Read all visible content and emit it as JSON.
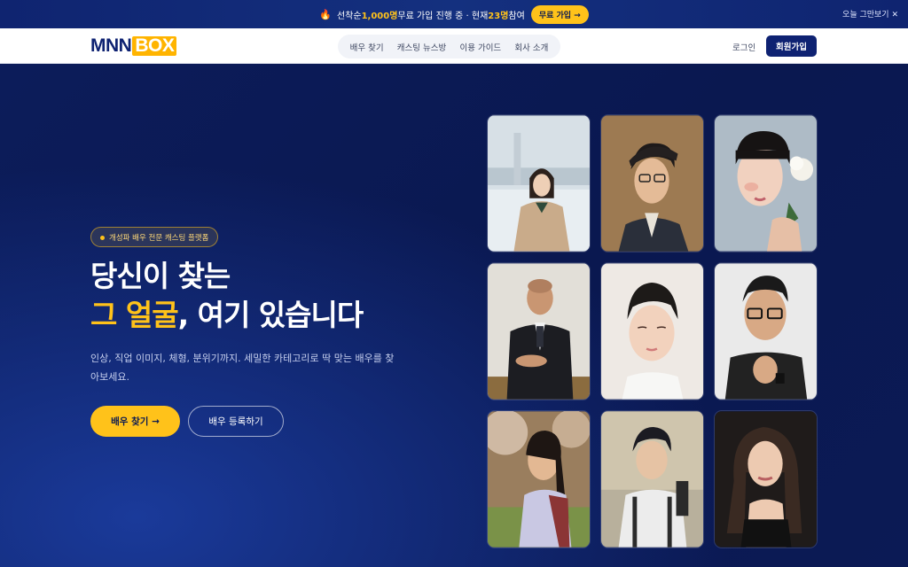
{
  "promo": {
    "fire_icon": "🔥",
    "text_prefix": "선착순 ",
    "highlight_count": "1,000명",
    "text_middle": " 무료 가입 진행 중 · 현재 ",
    "highlight_current": "23명",
    "text_suffix": " 참여",
    "button_label": "무료 가입 →",
    "close_label": "오늘 그만보기 ✕"
  },
  "header": {
    "logo_mnn": "MNN",
    "logo_box": "BOX",
    "nav": [
      "배우 찾기",
      "캐스팅 뉴스방",
      "이용 가이드",
      "회사 소개"
    ],
    "login": "로그인",
    "signup": "회원가입"
  },
  "hero": {
    "badge": "개성파 배우 전문 캐스팅 플랫폼",
    "title_line1": "당신이 찾는",
    "title_accent": "그 얼굴",
    "title_rest": ", 여기 있습니다",
    "description": "인상, 직업 이미지, 체형, 분위기까지. 세밀한 카테고리로 딱 맞는 배우를 찾아보세요.",
    "primary_button": "배우 찾기 →",
    "secondary_button": "배우 등록하기"
  },
  "colors": {
    "brand_navy": "#0e2272",
    "accent_yellow": "#ffc21a",
    "hero_bg": "#0b1a52"
  }
}
